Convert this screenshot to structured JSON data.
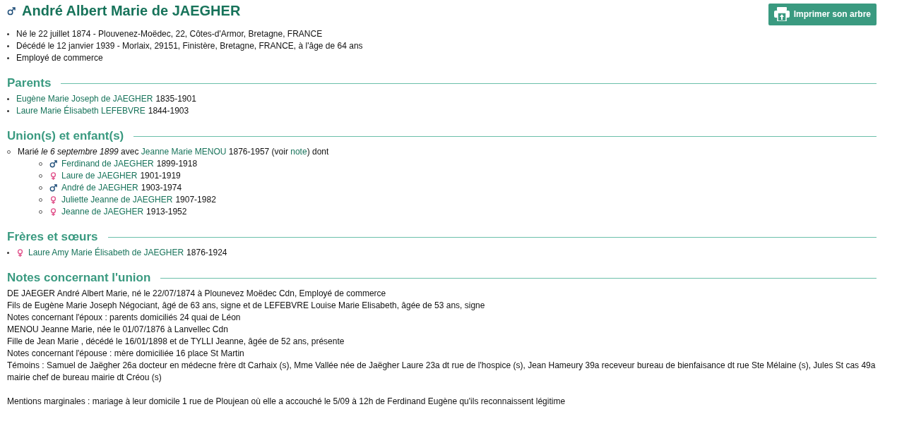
{
  "person": {
    "kind": "male",
    "name": "André Albert Marie de JAEGHER"
  },
  "print_button": {
    "label": "Imprimer son arbre"
  },
  "facts": [
    "Né le 22 juillet 1874 - Plouvenez-Moëdec, 22, Côtes-d'Armor, Bretagne, FRANCE",
    "Décédé le 12 janvier 1939 - Morlaix, 29151, Finistère, Bretagne, FRANCE, à l'âge de 64 ans",
    "Employé de commerce"
  ],
  "parents": {
    "title": "Parents",
    "items": [
      {
        "name": "Eugène Marie Joseph de JAEGHER",
        "years": "1835-1901"
      },
      {
        "name": "Laure Marie Élisabeth LEFEBVRE",
        "years": "1844-1903"
      }
    ]
  },
  "unions": {
    "title": "Union(s) et enfant(s)",
    "items": [
      {
        "prefix": "Marié *le 6 septembre 1899* avec",
        "spouse": "Jeanne Marie MENOU",
        "years": "1876-1957",
        "note_open": "(voir",
        "note_link": "note",
        "note_close": ") dont",
        "children": [
          {
            "kind": "male",
            "name": "Ferdinand de JAEGHER",
            "years": "1899-1918"
          },
          {
            "kind": "female",
            "name": "Laure de JAEGHER",
            "years": "1901-1919"
          },
          {
            "kind": "male",
            "name": "André de JAEGHER",
            "years": "1903-1974"
          },
          {
            "kind": "female",
            "name": "Juliette Jeanne de JAEGHER",
            "years": "1907-1982"
          },
          {
            "kind": "female",
            "name": "Jeanne de JAEGHER",
            "years": "1913-1952"
          }
        ]
      }
    ]
  },
  "siblings": {
    "title": "Frères et sœurs",
    "items": [
      {
        "kind": "female",
        "name": "Laure Amy Marie Élisabeth de JAEGHER",
        "years": "1876-1924"
      }
    ]
  },
  "notes": {
    "title": "Notes concernant l'union",
    "lines": [
      "DE JAEGER André Albert Marie, né le 22/07/1874 à Plounevez Moëdec Cdn, Employé de commerce",
      "Fils de Eugène Marie Joseph Négociant, âgé de 63 ans, signe et de LEFEBVRE Louise Marie Elisabeth, âgée de 53 ans, signe",
      "Notes concernant l'époux : parents domiciliés 24 quai de Léon",
      "MENOU Jeanne Marie, née le 01/07/1876 à Lanvellec Cdn",
      "Fille de Jean Marie , décédé le 16/01/1898 et de TYLLI Jeanne, âgée de 52 ans, présente",
      "Notes concernant l'épouse : mère domiciliée 16 place St Martin",
      "Témoins : Samuel de Jaëgher 26a docteur en médecne frère dt Carhaix (s), Mme Vallée née de Jaëgher Laure 23a dt rue de l'hospice (s), Jean Hameury 39a receveur bureau de bienfaisance dt rue Ste Mélaine (s), Jules St cas 49a mairie chef de bureau mairie dt Créou (s)"
    ],
    "mentions": "Mentions marginales : mariage à leur domicile 1 rue de Ploujean où elle a accouché le 5/09 à 12h de Ferdinand Eugène qu'ils reconnaissent légitime"
  }
}
